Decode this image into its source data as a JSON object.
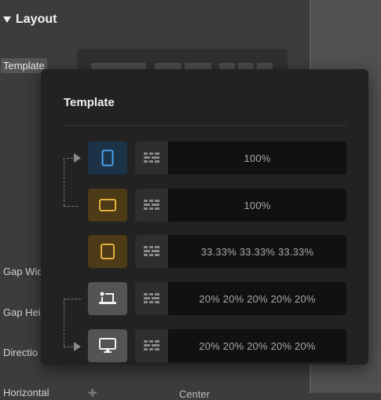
{
  "panel": {
    "section_title": "Layout",
    "template_label": "Template",
    "side_labels": [
      "Gap Wid",
      "Gap Hei",
      "Directio",
      "Horizontal"
    ],
    "bottom_value": "Center"
  },
  "popup": {
    "title": "Template",
    "rows": [
      {
        "device": "mobile-icon",
        "value": "100%",
        "accent": "#4aa3f0"
      },
      {
        "device": "tablet-icon",
        "value": "100%",
        "accent": "#e2b23d"
      },
      {
        "device": "tablet-icon",
        "value": "33.33% 33.33% 33.33%",
        "accent": "#e2b23d"
      },
      {
        "device": "laptop-icon",
        "value": "20% 20% 20% 20% 20%",
        "accent": "#f2f2f2"
      },
      {
        "device": "desktop-icon",
        "value": "20% 20% 20% 20% 20%",
        "accent": "#f2f2f2"
      }
    ]
  }
}
